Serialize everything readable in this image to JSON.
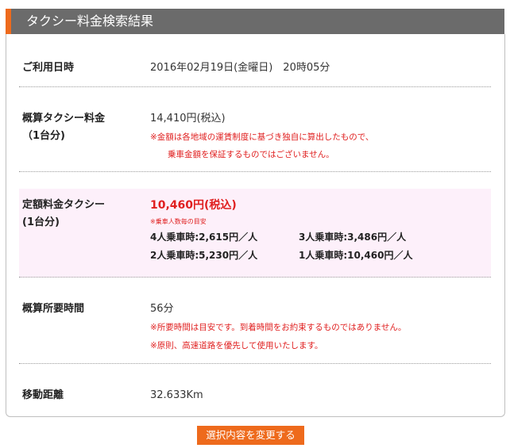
{
  "header": {
    "title": "タクシー料金検索結果",
    "accent_color": "#ee6a1c",
    "bg_color": "#6b6b6b"
  },
  "rows": {
    "datetime": {
      "label": "ご利用日時",
      "value": "2016年02月19日(金曜日)　20時05分"
    },
    "estimate": {
      "label_line1": "概算タクシー料金",
      "label_line2": "（1台分)",
      "value": "14,410円(税込)",
      "note_line1": "※金額は各地域の運賃制度に基づき独自に算出したもので、",
      "note_line2": "乗車金額を保証するものではございません。"
    },
    "fixed": {
      "label_line1": "定額料金タクシー",
      "label_line2": "(1台分)",
      "price": "10,460円(税込)",
      "note": "※乗車人数毎の目安",
      "fares": [
        "4人乗車時:2,615円／人",
        "3人乗車時:3,486円／人",
        "2人乗車時:5,230円／人",
        "1人乗車時:10,460円／人"
      ]
    },
    "duration": {
      "label": "概算所要時間",
      "value": "56分",
      "note_line1": "※所要時間は目安です。到着時間をお約束するものではありません。",
      "note_line2": "※原則、高速道路を優先して使用いたします。"
    },
    "distance": {
      "label": "移動距離",
      "value": "32.633Km"
    }
  },
  "button": {
    "label": "選択内容を変更する"
  },
  "colors": {
    "note_red": "#e02020",
    "pink_bg": "#fdf0fa"
  }
}
